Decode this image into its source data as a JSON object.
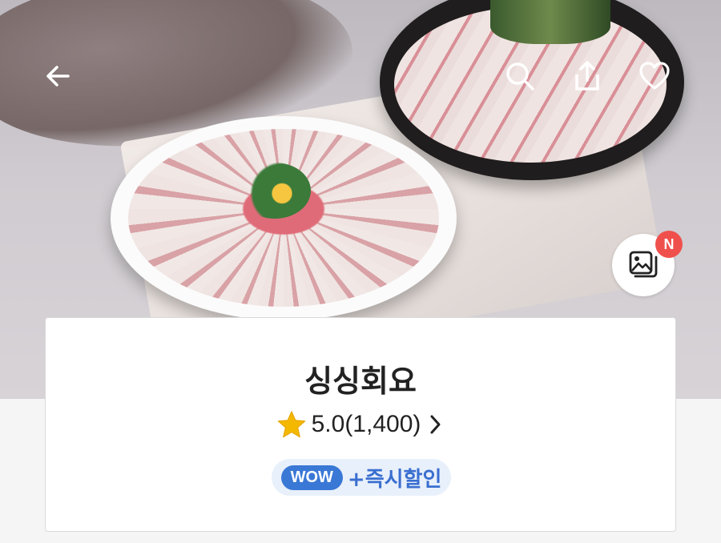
{
  "store": {
    "name": "싱싱회요",
    "rating": "5.0(1,400)"
  },
  "promo": {
    "badge": "WOW",
    "text": "+즉시할인"
  },
  "photo_badge": "N",
  "colors": {
    "accent_blue": "#3a78d6",
    "badge_red": "#f0504c",
    "star_yellow": "#f5b800"
  },
  "icons": [
    "back-arrow-icon",
    "search-icon",
    "share-icon",
    "heart-icon",
    "photo-album-icon",
    "star-icon",
    "chevron-right-icon"
  ]
}
